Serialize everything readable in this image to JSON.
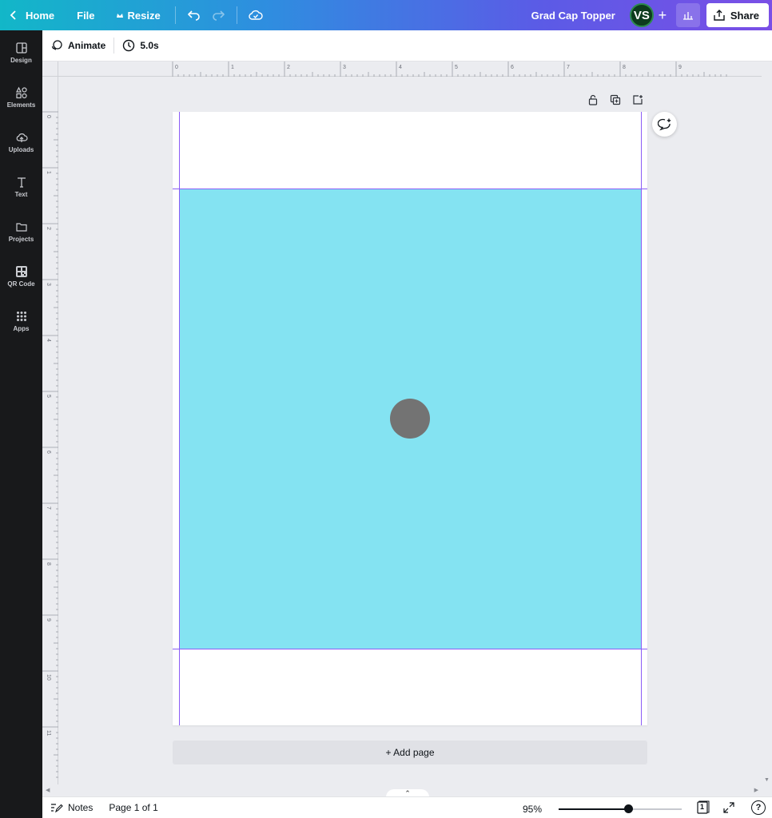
{
  "topbar": {
    "home_label": "Home",
    "file_label": "File",
    "resize_label": "Resize",
    "doc_title": "Grad Cap Topper",
    "avatar_initials": "VS",
    "share_label": "Share"
  },
  "sidebar": {
    "items": [
      {
        "label": "Design",
        "icon": "design-icon"
      },
      {
        "label": "Elements",
        "icon": "elements-icon"
      },
      {
        "label": "Uploads",
        "icon": "upload-cloud-icon"
      },
      {
        "label": "Text",
        "icon": "text-icon"
      },
      {
        "label": "Projects",
        "icon": "folder-icon"
      },
      {
        "label": "QR Code",
        "icon": "qr-code-icon"
      },
      {
        "label": "Apps",
        "icon": "apps-grid-icon"
      }
    ]
  },
  "toolbar": {
    "animate_label": "Animate",
    "duration_label": "5.0s"
  },
  "ruler": {
    "h_labels": [
      "0",
      "1",
      "2",
      "3",
      "4",
      "5",
      "6",
      "7",
      "8",
      "9"
    ],
    "v_labels": [
      "0",
      "1",
      "2",
      "3",
      "4",
      "5",
      "6",
      "7",
      "8",
      "9",
      "10",
      "11"
    ]
  },
  "canvas": {
    "add_page_label": "+ Add page",
    "rect_color": "#84e3f2",
    "circle_color": "#737373",
    "guide_color": "#8b5cf6"
  },
  "footer": {
    "notes_label": "Notes",
    "page_indicator": "Page 1 of 1",
    "zoom_label": "95%",
    "zoom_fraction": 0.57,
    "page_count_badge": "1",
    "help_label": "?"
  }
}
